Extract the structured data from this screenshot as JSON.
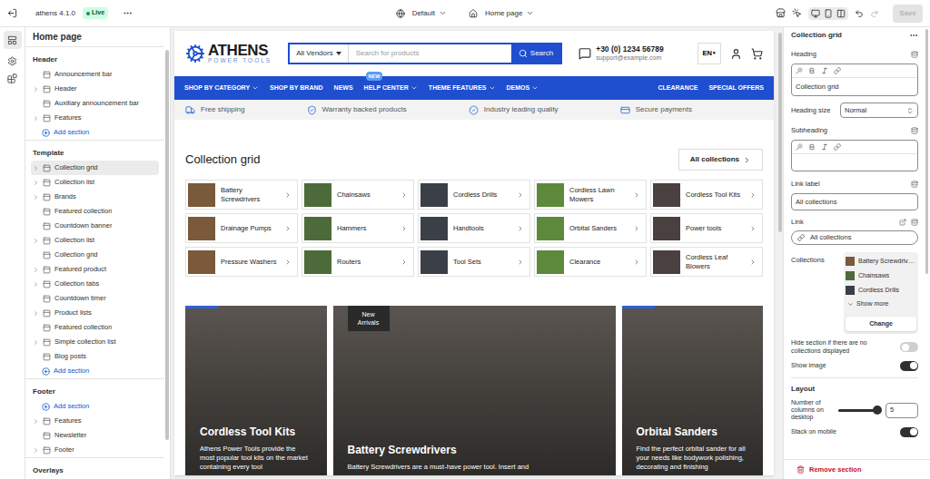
{
  "topbar": {
    "store": "athens 4.1.0",
    "status": "Live",
    "theme": "Default",
    "page": "Home page",
    "save": {
      "label": "Save",
      "disabled": true
    }
  },
  "sidebar": {
    "title": "Home page",
    "groups": [
      {
        "label": "Header",
        "items": [
          {
            "kind": "section",
            "label": "Announcement bar",
            "expandable": false,
            "selected": false
          },
          {
            "kind": "section",
            "label": "Header",
            "expandable": true,
            "selected": false
          },
          {
            "kind": "section",
            "label": "Auxiliary announcement bar",
            "expandable": false,
            "selected": false
          },
          {
            "kind": "section",
            "label": "Features",
            "expandable": true,
            "selected": false
          },
          {
            "kind": "add",
            "label": "Add section",
            "expandable": false,
            "selected": false
          }
        ]
      },
      {
        "label": "Template",
        "items": [
          {
            "kind": "section",
            "label": "Collection grid",
            "expandable": true,
            "selected": true
          },
          {
            "kind": "section",
            "label": "Collection list",
            "expandable": true,
            "selected": false
          },
          {
            "kind": "section",
            "label": "Brands",
            "expandable": true,
            "selected": false
          },
          {
            "kind": "section",
            "label": "Featured collection",
            "expandable": false,
            "selected": false
          },
          {
            "kind": "section",
            "label": "Countdown banner",
            "expandable": false,
            "selected": false
          },
          {
            "kind": "section",
            "label": "Collection list",
            "expandable": true,
            "selected": false
          },
          {
            "kind": "section",
            "label": "Collection grid",
            "expandable": false,
            "selected": false
          },
          {
            "kind": "section",
            "label": "Featured product",
            "expandable": true,
            "selected": false
          },
          {
            "kind": "section",
            "label": "Collection tabs",
            "expandable": true,
            "selected": false
          },
          {
            "kind": "section",
            "label": "Countdown timer",
            "expandable": false,
            "selected": false
          },
          {
            "kind": "section",
            "label": "Product lists",
            "expandable": true,
            "selected": false
          },
          {
            "kind": "section",
            "label": "Featured collection",
            "expandable": false,
            "selected": false
          },
          {
            "kind": "section",
            "label": "Simple collection list",
            "expandable": true,
            "selected": false
          },
          {
            "kind": "section",
            "label": "Blog posts",
            "expandable": false,
            "selected": false
          },
          {
            "kind": "add",
            "label": "Add section",
            "expandable": false,
            "selected": false
          }
        ]
      },
      {
        "label": "Footer",
        "items": [
          {
            "kind": "add",
            "label": "Add section",
            "expandable": false,
            "selected": false
          },
          {
            "kind": "section",
            "label": "Features",
            "expandable": true,
            "selected": false
          },
          {
            "kind": "section",
            "label": "Newsletter",
            "expandable": false,
            "selected": false
          },
          {
            "kind": "section",
            "label": "Footer",
            "expandable": true,
            "selected": false
          }
        ]
      },
      {
        "label": "Overlays",
        "items": []
      }
    ]
  },
  "preview": {
    "logo": {
      "name": "ATHENS",
      "tagline": "POWER TOOLS"
    },
    "search": {
      "vendor": "All Vendors",
      "placeholder": "Search for products",
      "button": "Search"
    },
    "contact": {
      "phone": "+30 (0) 1234 56789",
      "email": "support@example.com"
    },
    "language": "EN",
    "nav": {
      "left": [
        {
          "label": "SHOP BY CATEGORY",
          "dropdown": true
        },
        {
          "label": "SHOP BY BRAND",
          "dropdown": false
        },
        {
          "label": "NEWS",
          "dropdown": false
        },
        {
          "label": "HELP CENTER",
          "dropdown": true,
          "badge": "NEW"
        },
        {
          "label": "THEME FEATURES",
          "dropdown": true
        },
        {
          "label": "DEMOS",
          "dropdown": true
        }
      ],
      "right": [
        "CLEARANCE",
        "SPECIAL OFFERS"
      ]
    },
    "features": [
      "Free shipping",
      "Warranty backed products",
      "Industry leading quality",
      "Secure payments"
    ],
    "section": {
      "title": "Collection grid",
      "link": "All collections",
      "collections": [
        "Battery Screwdrivers",
        "Chainsaws",
        "Cordless Drills",
        "Cordless Lawn Mowers",
        "Cordless Tool Kits",
        "Drainage Pumps",
        "Hammers",
        "Handtools",
        "Orbital Sanders",
        "Power tools",
        "Pressure Washers",
        "Routers",
        "Tool Sets",
        "Clearance",
        "Cordless Leaf Blowers"
      ]
    },
    "banners": [
      {
        "title": "Cordless Tool Kits",
        "description": "Athens Power Tools provide the most popular tool kits on the market containing every tool"
      },
      {
        "title": "Battery Screwdrivers",
        "description": "Battery Screwdrivers are a must-have power tool. Insert and",
        "badge": "New Arrivals"
      },
      {
        "title": "Orbital Sanders",
        "description": "Find the perfect orbital sander for all your needs like bodywork polishing, decorating and finishing"
      }
    ]
  },
  "inspector": {
    "title": "Collection grid",
    "heading": {
      "label": "Heading",
      "value": "Collection grid"
    },
    "heading_size": {
      "label": "Heading size",
      "value": "Normal"
    },
    "subheading": {
      "label": "Subheading"
    },
    "link_label": {
      "label": "Link label",
      "value": "All collections"
    },
    "link": {
      "label": "Link",
      "value": "All collections"
    },
    "collections": {
      "label": "Collections",
      "items": [
        "Battery Screwdrivers",
        "Chainsaws",
        "Cordless Drills"
      ],
      "more": "Show more",
      "button": "Change"
    },
    "toggles": [
      {
        "label": "Hide section if there are no collections displayed",
        "on": false
      },
      {
        "label": "Show image",
        "on": true
      }
    ],
    "layout": {
      "title": "Layout",
      "columns": {
        "label": "Number of columns on desktop",
        "level": 1,
        "value": "5"
      },
      "stack": {
        "label": "Stack on mobile",
        "on": true
      }
    },
    "remove": "Remove section"
  }
}
